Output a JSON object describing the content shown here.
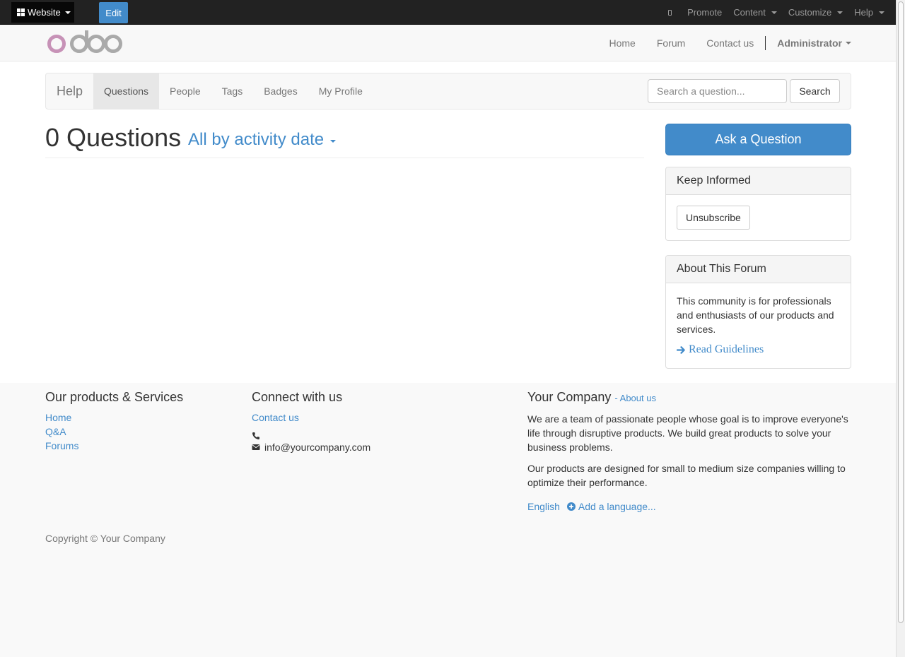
{
  "adminbar": {
    "apps_label": "Website",
    "edit_label": "Edit",
    "promote_label": "Promote",
    "content_label": "Content",
    "customize_label": "Customize",
    "help_label": "Help"
  },
  "header": {
    "logo_text": "odoo",
    "nav": [
      "Home",
      "Forum",
      "Contact us"
    ],
    "user_label": "Administrator"
  },
  "forum_nav": {
    "brand": "Help",
    "tabs": [
      "Questions",
      "People",
      "Tags",
      "Badges",
      "My Profile"
    ],
    "active_tab": "Questions",
    "search_placeholder": "Search a question...",
    "search_button": "Search"
  },
  "questions": {
    "count_label": "0 Questions",
    "sort_label": "All by activity date"
  },
  "sidebar": {
    "ask_button": "Ask a Question",
    "keep_informed_title": "Keep Informed",
    "unsubscribe_label": "Unsubscribe",
    "about_title": "About This Forum",
    "about_text": "This community is for professionals and enthusiasts of our products and services.",
    "guidelines_label": "Read Guidelines"
  },
  "footer": {
    "products_title": "Our products & Services",
    "products_links": [
      "Home",
      "Q&A",
      "Forums"
    ],
    "connect_title": "Connect with us",
    "connect_link": "Contact us",
    "phone": "",
    "email": "info@yourcompany.com",
    "company_title": "Your Company",
    "about_link": "- About us",
    "company_text_1": "We are a team of passionate people whose goal is to improve everyone's life through disruptive products. We build great products to solve your business problems.",
    "company_text_2": "Our products are designed for small to medium size companies willing to optimize their performance.",
    "language": "English",
    "add_language": "Add a language...",
    "copyright": "Copyright © Your Company"
  },
  "colors": {
    "primary": "#428bca",
    "adminbar_bg": "#222222",
    "logo_pink": "#c792b7",
    "logo_gray": "#aaaaaa"
  }
}
